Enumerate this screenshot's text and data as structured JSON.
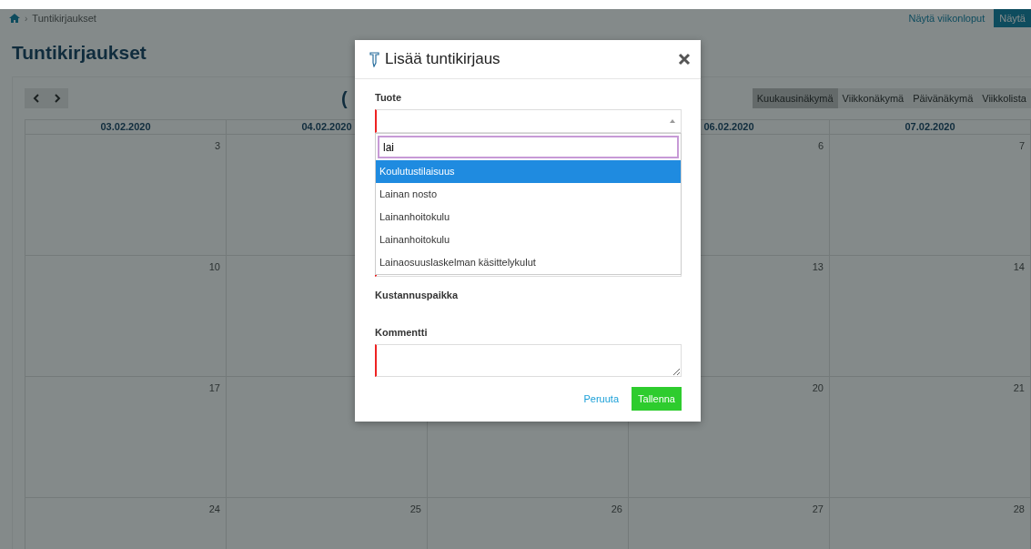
{
  "breadcrumb": {
    "separator": "›",
    "current": "Tuntikirjaukset"
  },
  "top_actions": [
    {
      "label": "Näytä viikonloput",
      "kind": "link"
    },
    {
      "label": "Näytä",
      "kind": "button"
    }
  ],
  "page_title": "Tuntikirjaukset",
  "calendar": {
    "month_title": "(",
    "views": [
      {
        "label": "Kuukausinäkymä",
        "selected": true
      },
      {
        "label": "Viikkonäkymä",
        "selected": false
      },
      {
        "label": "Päivänäkymä",
        "selected": false
      },
      {
        "label": "Viikkolista",
        "selected": false
      }
    ],
    "columns": [
      {
        "header": "03.02.2020",
        "days": [
          "3",
          "10",
          "17",
          "24"
        ]
      },
      {
        "header": "04.02.2020",
        "days": [
          "25"
        ]
      },
      {
        "days": [
          "26"
        ]
      },
      {
        "header": "06.02.2020",
        "days": [
          "6",
          "13",
          "20",
          "27"
        ]
      },
      {
        "header": "07.02.2020",
        "days": [
          "7",
          "14",
          "21",
          "28"
        ]
      }
    ]
  },
  "dialog": {
    "title": "Lisää tuntikirjaus",
    "product": {
      "label": "Tuote",
      "required": true,
      "search_value": "lai",
      "options": [
        {
          "label": "Koulutustilaisuus",
          "selected": true
        },
        {
          "label": "Lainan nosto",
          "selected": false
        },
        {
          "label": "Lainanhoitokulu",
          "selected": false
        },
        {
          "label": "Lainanhoitokulu",
          "selected": false
        },
        {
          "label": "Lainaosuuslaskelman käsittelykulut",
          "selected": false
        }
      ]
    },
    "cost_center": {
      "label": "Kustannuspaikka"
    },
    "comment": {
      "label": "Kommentti",
      "required": true
    },
    "buttons": [
      {
        "label": "Peruuta",
        "kind": "link"
      },
      {
        "label": "Tallenna",
        "kind": "primary"
      }
    ]
  }
}
